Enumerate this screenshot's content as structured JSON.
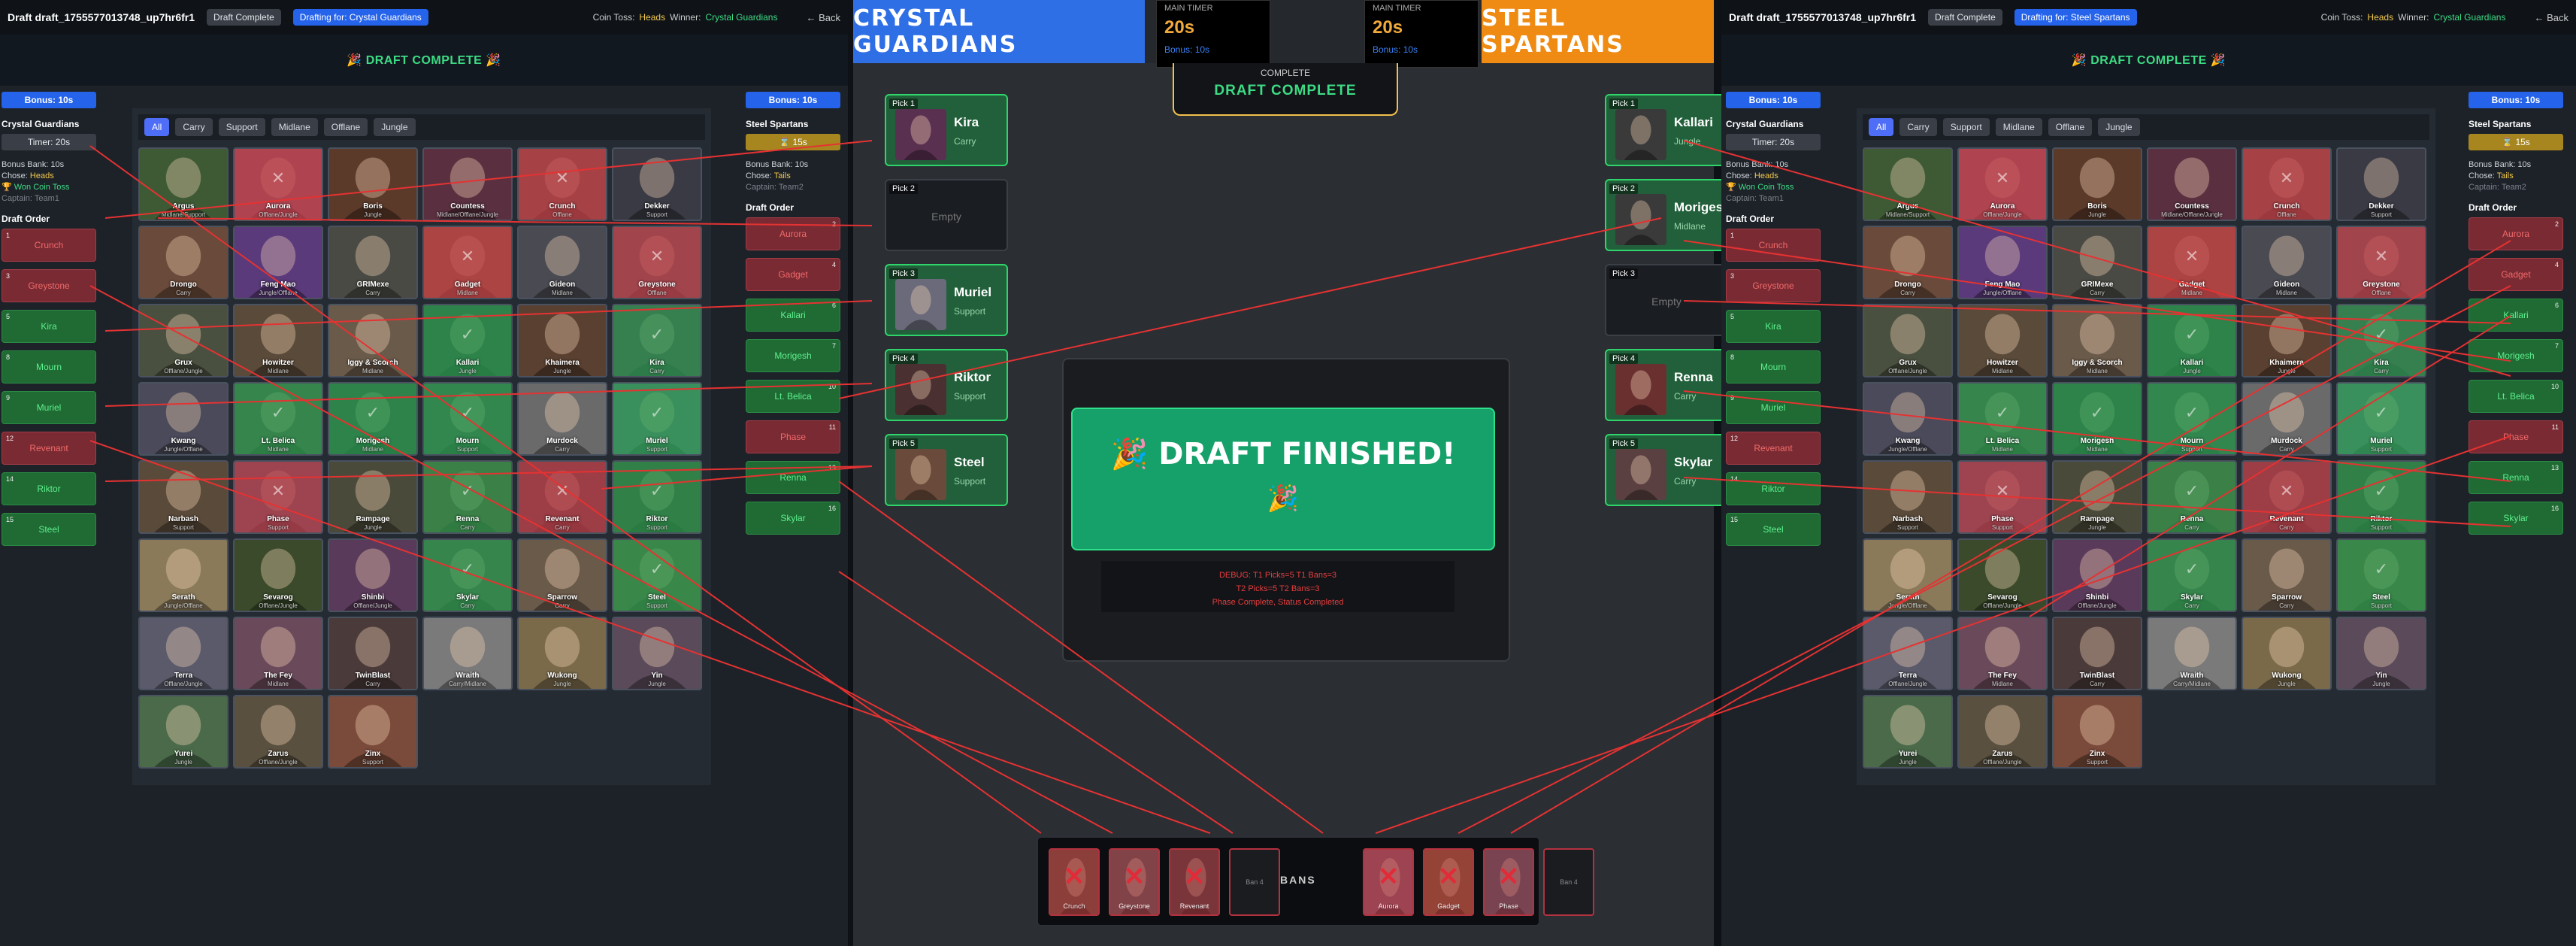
{
  "left": {
    "header": {
      "title": "Draft draft_1755577013748_up7hr6fr1",
      "status": "Draft Complete",
      "drafting": "Drafting for: Crystal Guardians",
      "coin_label": "Coin Toss:",
      "coin_value": "Heads",
      "winner_label": "Winner:",
      "winner_value": "Crystal Guardians",
      "back": "← Back"
    },
    "banner": "🎉 DRAFT COMPLETE 🎉",
    "team_a": {
      "bonus": "Bonus: 10s",
      "name": "Crystal Guardians",
      "timer": "Timer: 20s",
      "info": [
        "Bonus Bank: 10s",
        "Chose: ",
        "Heads",
        "🏆 Won Coin Toss",
        "Captain: Team1"
      ]
    },
    "team_b": {
      "bonus": "Bonus: 10s",
      "name": "Steel Spartans",
      "timer": "⌛ 15s",
      "info": [
        "Bonus Bank: 10s",
        "Chose: ",
        "Tails",
        "Captain: Team2"
      ]
    }
  },
  "right": {
    "header": {
      "title": "Draft draft_1755577013748_up7hr6fr1",
      "status": "Draft Complete",
      "drafting": "Drafting for: Steel Spartans",
      "coin_label": "Coin Toss:",
      "coin_value": "Heads",
      "winner_label": "Winner:",
      "winner_value": "Crystal Guardians",
      "back": "← Back"
    },
    "banner": "🎉 DRAFT COMPLETE 🎉",
    "team_a": {
      "bonus": "Bonus: 10s",
      "name": "Crystal Guardians",
      "timer": "Timer: 20s",
      "info": [
        "Bonus Bank: 10s",
        "Chose: ",
        "Heads",
        "🏆 Won Coin Toss",
        "Captain: Team1"
      ]
    },
    "team_b": {
      "bonus": "Bonus: 10s",
      "name": "Steel Spartans",
      "timer": "⌛ 15s",
      "info": [
        "Bonus Bank: 10s",
        "Chose: ",
        "Tails",
        "Captain: Team2"
      ]
    }
  },
  "draft_order_label": "Draft Order",
  "draft_order_a": [
    {
      "n": "1",
      "name": "Crunch",
      "type": "ban"
    },
    {
      "n": "3",
      "name": "Greystone",
      "type": "ban"
    },
    {
      "n": "5",
      "name": "Kira",
      "type": "pick"
    },
    {
      "n": "8",
      "name": "Mourn",
      "type": "pick"
    },
    {
      "n": "9",
      "name": "Muriel",
      "type": "pick"
    },
    {
      "n": "12",
      "name": "Revenant",
      "type": "ban"
    },
    {
      "n": "14",
      "name": "Riktor",
      "type": "pick"
    },
    {
      "n": "15",
      "name": "Steel",
      "type": "pick"
    }
  ],
  "draft_order_b": [
    {
      "n": "2",
      "name": "Aurora",
      "type": "ban"
    },
    {
      "n": "4",
      "name": "Gadget",
      "type": "ban"
    },
    {
      "n": "6",
      "name": "Kallari",
      "type": "pick"
    },
    {
      "n": "7",
      "name": "Morigesh",
      "type": "pick"
    },
    {
      "n": "10",
      "name": "Lt. Belica",
      "type": "pick"
    },
    {
      "n": "11",
      "name": "Phase",
      "type": "ban"
    },
    {
      "n": "13",
      "name": "Renna",
      "type": "pick"
    },
    {
      "n": "16",
      "name": "Skylar",
      "type": "pick"
    }
  ],
  "filters": [
    "All",
    "Carry",
    "Support",
    "Midlane",
    "Offlane",
    "Jungle"
  ],
  "heroes": [
    {
      "name": "Argus",
      "role": "Midlane/Support",
      "state": "",
      "c": "#3e5a35"
    },
    {
      "name": "Aurora",
      "role": "Offlane/Jungle",
      "state": "banned",
      "c": "#8a5a6a"
    },
    {
      "name": "Boris",
      "role": "Jungle",
      "state": "",
      "c": "#5b3a2a"
    },
    {
      "name": "Countess",
      "role": "Midlane/Offlane/Jungle",
      "state": "",
      "c": "#5a3040"
    },
    {
      "name": "Crunch",
      "role": "Offlane",
      "state": "banned",
      "c": "#6a5040"
    },
    {
      "name": "Dekker",
      "role": "Support",
      "state": "",
      "c": "#3a3a44"
    },
    {
      "name": "Drongo",
      "role": "Carry",
      "state": "",
      "c": "#6a4a3a"
    },
    {
      "name": "Feng Mao",
      "role": "Jungle/Offlane",
      "state": "",
      "c": "#5a3a7a"
    },
    {
      "name": "GRIMexe",
      "role": "Carry",
      "state": "",
      "c": "#4a4a44"
    },
    {
      "name": "Gadget",
      "role": "Midlane",
      "state": "banned",
      "c": "#7a5a3a"
    },
    {
      "name": "Gideon",
      "role": "Midlane",
      "state": "",
      "c": "#4a4a52"
    },
    {
      "name": "Greystone",
      "role": "Offlane",
      "state": "banned",
      "c": "#5a5a5a"
    },
    {
      "name": "Grux",
      "role": "Offlane/Jungle",
      "state": "",
      "c": "#4a5040"
    },
    {
      "name": "Howitzer",
      "role": "Midlane",
      "state": "",
      "c": "#5a4a3a"
    },
    {
      "name": "Iggy & Scorch",
      "role": "Midlane",
      "state": "",
      "c": "#6a5a4a"
    },
    {
      "name": "Kallari",
      "role": "Jungle",
      "state": "picked",
      "c": "#3a3a3a"
    },
    {
      "name": "Khaimera",
      "role": "Jungle",
      "state": "",
      "c": "#5a4030"
    },
    {
      "name": "Kira",
      "role": "Carry",
      "state": "picked",
      "c": "#5a3050"
    },
    {
      "name": "Kwang",
      "role": "Jungle/Offlane",
      "state": "",
      "c": "#4a4a5a"
    },
    {
      "name": "Lt. Belica",
      "role": "Midlane",
      "state": "picked",
      "c": "#5a4040"
    },
    {
      "name": "Morigesh",
      "role": "Midlane",
      "state": "picked",
      "c": "#3a3a3a"
    },
    {
      "name": "Mourn",
      "role": "Support",
      "state": "picked",
      "c": "#4a4a4a"
    },
    {
      "name": "Murdock",
      "role": "Carry",
      "state": "",
      "c": "#6a6a6a"
    },
    {
      "name": "Muriel",
      "role": "Support",
      "state": "picked",
      "c": "#6a6a7a"
    },
    {
      "name": "Narbash",
      "role": "Support",
      "state": "",
      "c": "#5a4a3a"
    },
    {
      "name": "Phase",
      "role": "Support",
      "state": "banned",
      "c": "#4a5a6a"
    },
    {
      "name": "Rampage",
      "role": "Jungle",
      "state": "",
      "c": "#4a4a3a"
    },
    {
      "name": "Renna",
      "role": "Carry",
      "state": "picked",
      "c": "#6a3030"
    },
    {
      "name": "Revenant",
      "role": "Carry",
      "state": "banned",
      "c": "#4a4040"
    },
    {
      "name": "Riktor",
      "role": "Support",
      "state": "picked",
      "c": "#4a3030"
    },
    {
      "name": "Serath",
      "role": "Jungle/Offlane",
      "state": "",
      "c": "#8a7a5a"
    },
    {
      "name": "Sevarog",
      "role": "Offlane/Jungle",
      "state": "",
      "c": "#3a4a2a"
    },
    {
      "name": "Shinbi",
      "role": "Offlane/Jungle",
      "state": "",
      "c": "#5a3a5a"
    },
    {
      "name": "Skylar",
      "role": "Carry",
      "state": "picked",
      "c": "#5a4040"
    },
    {
      "name": "Sparrow",
      "role": "Carry",
      "state": "",
      "c": "#6a5a4a"
    },
    {
      "name": "Steel",
      "role": "Support",
      "state": "picked",
      "c": "#6a4a3a"
    },
    {
      "name": "Terra",
      "role": "Offlane/Jungle",
      "state": "",
      "c": "#5a5a6a"
    },
    {
      "name": "The Fey",
      "role": "Midlane",
      "state": "",
      "c": "#6a4a5a"
    },
    {
      "name": "TwinBlast",
      "role": "Carry",
      "state": "",
      "c": "#4a3a3a"
    },
    {
      "name": "Wraith",
      "role": "Carry/Midlane",
      "state": "",
      "c": "#7a7a7a"
    },
    {
      "name": "Wukong",
      "role": "Jungle",
      "state": "",
      "c": "#7a6a4a"
    },
    {
      "name": "Yin",
      "role": "Jungle",
      "state": "",
      "c": "#5a4a5a"
    },
    {
      "name": "Yurei",
      "role": "Jungle",
      "state": "",
      "c": "#4a6a4a"
    },
    {
      "name": "Zarus",
      "role": "Offlane/Jungle",
      "state": "",
      "c": "#5a5040"
    },
    {
      "name": "Zinx",
      "role": "Support",
      "state": "",
      "c": "#7a4a3a"
    }
  ],
  "center": {
    "team_a_name": "CRYSTAL GUARDIANS",
    "team_b_name": "STEEL SPARTANS",
    "timer_a": {
      "label": "MAIN TIMER",
      "value": "20s",
      "bonus": "Bonus: 10s"
    },
    "timer_b": {
      "label": "MAIN TIMER",
      "value": "20s",
      "bonus": "Bonus: 10s"
    },
    "status_small": "COMPLETE",
    "status_big": "DRAFT COMPLETE",
    "finish_title": "🎉 DRAFT FINISHED!",
    "finish_emoji": "🎉",
    "debug": [
      "DEBUG: T1 Picks=5 T1 Bans=3",
      "T2 Picks=5 T2 Bans=3",
      "Phase Complete, Status Completed"
    ],
    "picks_a": [
      {
        "slot": "Pick 1",
        "name": "Kira",
        "role": "Carry",
        "c": "#5a3050"
      },
      {
        "slot": "Pick 2",
        "name": "",
        "role": "",
        "empty": "Empty"
      },
      {
        "slot": "Pick 3",
        "name": "Muriel",
        "role": "Support",
        "c": "#6a6a7a"
      },
      {
        "slot": "Pick 4",
        "name": "Riktor",
        "role": "Support",
        "c": "#4a3030"
      },
      {
        "slot": "Pick 5",
        "name": "Steel",
        "role": "Support",
        "c": "#6a4a3a"
      }
    ],
    "picks_b": [
      {
        "slot": "Pick 1",
        "name": "Kallari",
        "role": "Jungle",
        "c": "#3a3a3a"
      },
      {
        "slot": "Pick 2",
        "name": "Morigesh",
        "role": "Midlane",
        "c": "#3a3a3a"
      },
      {
        "slot": "Pick 3",
        "name": "",
        "role": "",
        "empty": "Empty"
      },
      {
        "slot": "Pick 4",
        "name": "Renna",
        "role": "Carry",
        "c": "#6a3030"
      },
      {
        "slot": "Pick 5",
        "name": "Skylar",
        "role": "Carry",
        "c": "#5a4040"
      }
    ],
    "bans_label": "BANS",
    "bans_a": [
      {
        "name": "Crunch",
        "c": "#6a5040"
      },
      {
        "name": "Greystone",
        "c": "#5a5a5a"
      },
      {
        "name": "Revenant",
        "c": "#4a4040"
      },
      {
        "name": "Ban 4",
        "empty": true
      }
    ],
    "bans_b": [
      {
        "name": "Aurora",
        "c": "#8a5a6a"
      },
      {
        "name": "Gadget",
        "c": "#7a5a3a"
      },
      {
        "name": "Phase",
        "c": "#4a5a6a"
      },
      {
        "name": "Ban 4",
        "empty": true
      }
    ]
  }
}
